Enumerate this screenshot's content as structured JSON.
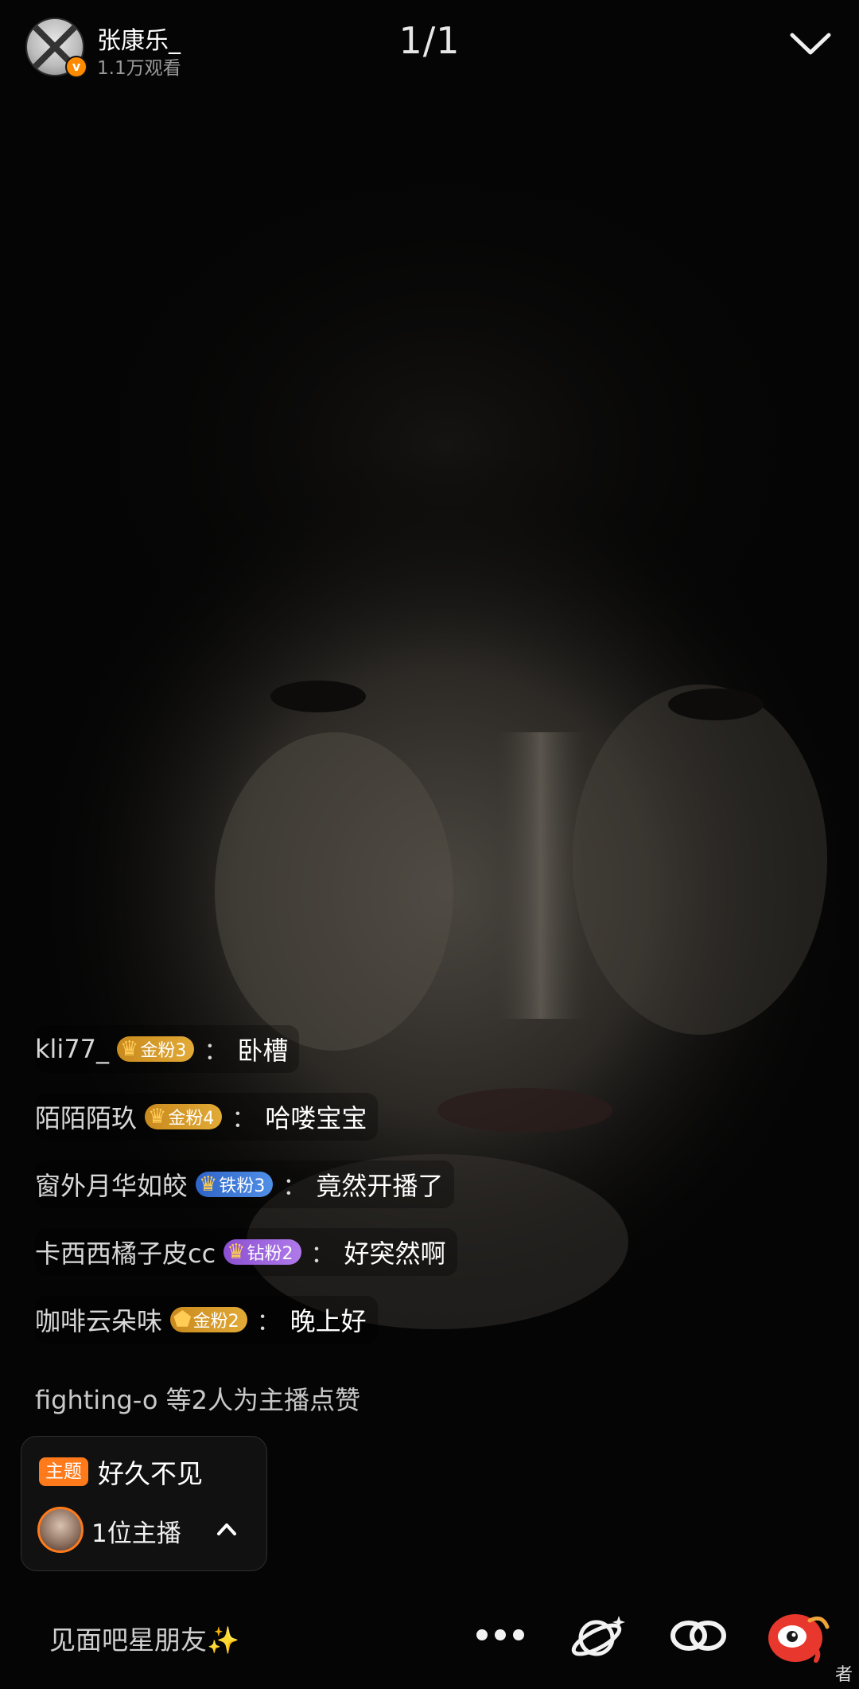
{
  "header": {
    "host_name": "张康乐_",
    "view_count": "1.1万观看",
    "page_counter": "1/1",
    "verified_mark": "v"
  },
  "chat": {
    "messages": [
      {
        "user": "kli77_",
        "badge": "金粉3",
        "badge_type": "gold",
        "message": "卧槽"
      },
      {
        "user": "陌陌陌玖",
        "badge": "金粉4",
        "badge_type": "gold",
        "message": "哈喽宝宝"
      },
      {
        "user": "窗外月华如皎",
        "badge": "铁粉3",
        "badge_type": "iron",
        "message": "竟然开播了"
      },
      {
        "user": "卡西西橘子皮cc",
        "badge": "钻粉2",
        "badge_type": "diamond",
        "message": "好突然啊"
      },
      {
        "user": "咖啡云朵味",
        "badge": "金粉2",
        "badge_type": "gold",
        "message": "晚上好"
      }
    ],
    "colon": "：",
    "like_notice": "fighting-o 等2人为主播点赞"
  },
  "topic": {
    "tag": "主题",
    "title": "好久不见",
    "host_count": "1位主播"
  },
  "bottom_bar": {
    "comment_placeholder": "见面吧星朋友✨",
    "corner_glyph": "者"
  },
  "icons": [
    "collapse-chevron-icon",
    "more-dots-icon",
    "planet-icon",
    "link-icon",
    "app-logo-icon",
    "crown-icon",
    "chevron-up-icon"
  ],
  "colors": {
    "accent_orange": "#ff7a1a",
    "badge_gold": "#d89a2a",
    "badge_iron": "#3f7bd8",
    "badge_diamond": "#9a62dc",
    "logo_red": "#e8382d"
  }
}
